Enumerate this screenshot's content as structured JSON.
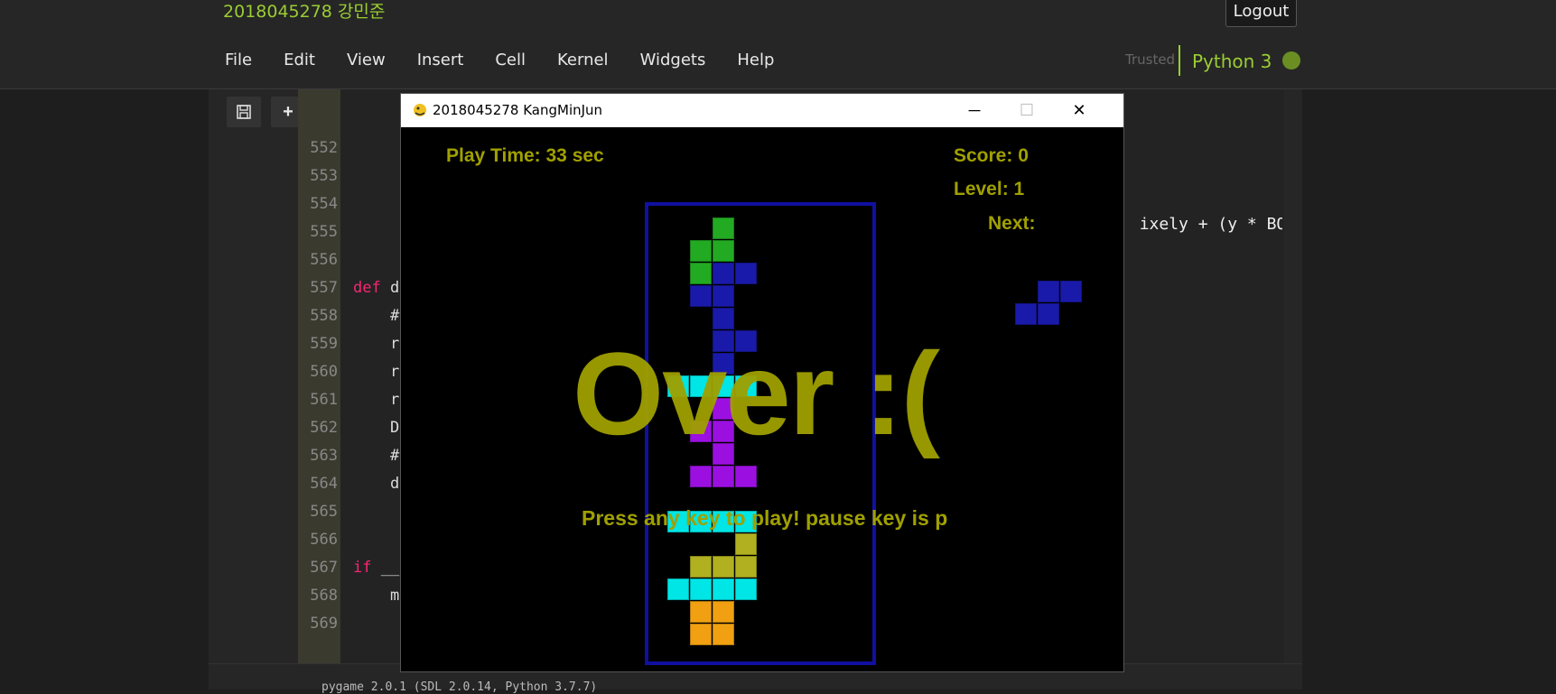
{
  "header": {
    "user_title": "2018045278 강민준",
    "logout_label": "Logout",
    "menu": [
      "File",
      "Edit",
      "View",
      "Insert",
      "Cell",
      "Kernel",
      "Widgets",
      "Help"
    ],
    "trusted": "Trusted",
    "kernel": "Python 3"
  },
  "toolbar": {
    "icons": [
      "save-icon",
      "plus-icon",
      "scissors-icon",
      "copy-icon"
    ]
  },
  "editor": {
    "lines": [
      {
        "n": "552",
        "text": ""
      },
      {
        "n": "553",
        "text": ""
      },
      {
        "n": "554",
        "text": ""
      },
      {
        "n": "555",
        "text": ""
      },
      {
        "n": "556",
        "text": ""
      },
      {
        "n": "557",
        "kw": "def",
        "text": " d"
      },
      {
        "n": "558",
        "text": "    #"
      },
      {
        "n": "559",
        "text": "    r"
      },
      {
        "n": "560",
        "text": "    r"
      },
      {
        "n": "561",
        "text": "    r"
      },
      {
        "n": "562",
        "text": "    D"
      },
      {
        "n": "563",
        "text": "    #"
      },
      {
        "n": "564",
        "text": "    d"
      },
      {
        "n": "565",
        "text": ""
      },
      {
        "n": "566",
        "text": ""
      },
      {
        "n": "567",
        "kw": "if",
        "text": " __"
      },
      {
        "n": "568",
        "text": "    m"
      },
      {
        "n": "569",
        "text": ""
      }
    ],
    "right_fragment": "ixely + (y * BOXS",
    "output": "pygame 2.0.1 (SDL 2.0.14, Python 3.7.7)"
  },
  "pygame_window": {
    "title": "2018045278 KangMinJun",
    "play_time": "Play Time: 33 sec",
    "score": "Score: 0",
    "level": "Level: 1",
    "next": "Next:",
    "game_over": "Over :(",
    "press_key": "Press any key to play! pause key is p",
    "colors": {
      "green": "#22aa22",
      "blue": "#1a1aaa",
      "cyan": "#00e5e5",
      "purple": "#9b10e0",
      "olive": "#b0b020",
      "orange": "#f0a010",
      "board_border": "#1010a0",
      "text": "#a0a000"
    }
  }
}
